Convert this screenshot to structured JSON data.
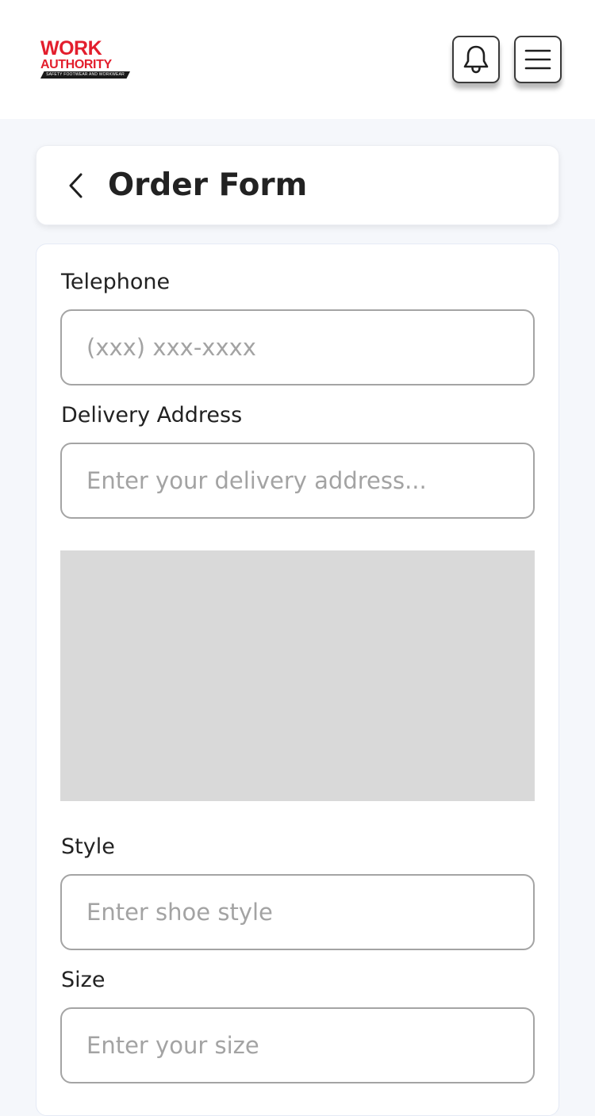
{
  "header": {
    "logo": {
      "line1": "WORK",
      "line2": "AUTHORITY",
      "tagline": "SAFETY FOOTWEAR AND WORKWEAR"
    },
    "notifications_icon": "bell-icon",
    "menu_icon": "hamburger-menu-icon"
  },
  "page": {
    "back_icon": "chevron-left-icon",
    "title": "Order Form"
  },
  "form": {
    "telephone": {
      "label": "Telephone",
      "placeholder": "(xxx) xxx-xxxx",
      "value": ""
    },
    "delivery_address": {
      "label": "Delivery Address",
      "placeholder": "Enter your delivery address...",
      "value": ""
    },
    "style": {
      "label": "Style",
      "placeholder": "Enter shoe style",
      "value": ""
    },
    "size": {
      "label": "Size",
      "placeholder": "Enter your size",
      "value": ""
    }
  },
  "colors": {
    "brand_red": "#e31e2d",
    "page_background": "#f5f7fb",
    "card_background": "#ffffff",
    "input_border": "#a4a4a4",
    "placeholder_text": "#a3a3a3",
    "map_placeholder": "#d9d9d9"
  }
}
